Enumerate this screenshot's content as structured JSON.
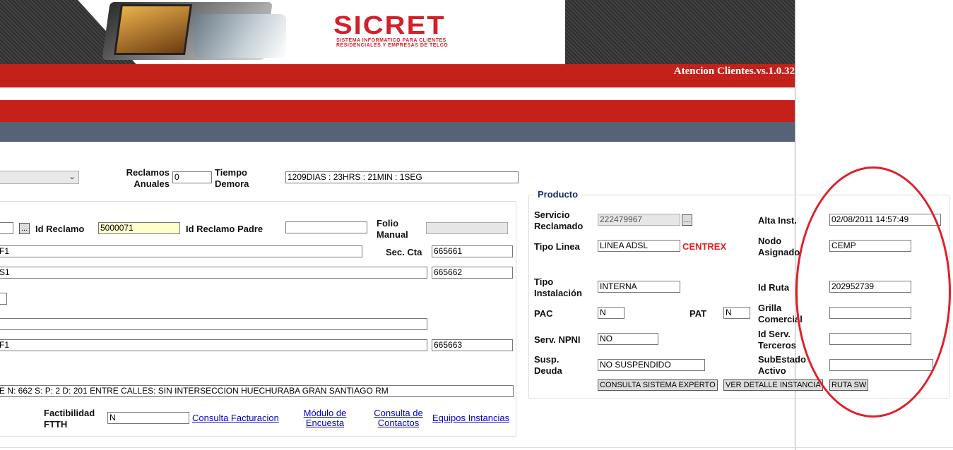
{
  "header": {
    "logo_text": "SICRET",
    "logo_subtitle_1": "SISTEMA INFORMATICO PARA CLIENTES",
    "logo_subtitle_2": "RESIDENCIALES Y EMPRESAS DE TELCO",
    "version": "Atencion Clientes.vs.1.0.32"
  },
  "top": {
    "reclamos_anuales_label_1": "Reclamos",
    "reclamos_anuales_label_2": "Anuales",
    "reclamos_anuales_value": "0",
    "tiempo_demora_label_1": "Tiempo",
    "tiempo_demora_label_2": "Demora",
    "tiempo_demora_value": "1209DIAS : 23HRS : 21MIN : 1SEG"
  },
  "left": {
    "dots_button": "...",
    "id_reclamo_label": "Id Reclamo",
    "id_reclamo_value": "5000071",
    "id_reclamo_padre_label": "Id Reclamo Padre",
    "id_reclamo_padre_value": "",
    "folio_manual_label_1": "Folio",
    "folio_manual_label_2": "Manual",
    "folio_manual_value": "",
    "row1_value": "F1",
    "sec_cta_label": "Sec. Cta",
    "sec_cta_value": "665661",
    "row2_value": "S1",
    "row2_right_value": "665662",
    "row4_value": "F1",
    "row4_right_value": "665663",
    "address_value": "E N: 662 S:  P: 2 D: 201 ENTRE CALLES: SIN INTERSECCION  HUECHURABA GRAN SANTIAGO RM",
    "factibilidad_label_1": "Factibilidad",
    "factibilidad_label_2": "FTTH",
    "factibilidad_value": "N",
    "link_consulta_facturacion": "Consulta Facturacion",
    "link_modulo_encuesta_1": "Módulo de",
    "link_modulo_encuesta_2": "Encuesta",
    "link_consulta_contactos_1": "Consulta de",
    "link_consulta_contactos_2": "Contactos",
    "link_equipos_instancias": "Equipos Instancias"
  },
  "producto": {
    "title": "Producto",
    "servicio_reclamado_label_1": "Servicio",
    "servicio_reclamado_label_2": "Reclamado",
    "servicio_reclamado_value": "222479967",
    "dots_button": "...",
    "alta_inst_label": "Alta Inst.",
    "alta_inst_value": "02/08/2011 14:57:49",
    "tipo_linea_label": "Tipo Linea",
    "tipo_linea_value": "LINEA ADSL",
    "centrex": "CENTREX",
    "nodo_asignado_label_1": "Nodo",
    "nodo_asignado_label_2": "Asignado",
    "nodo_asignado_value": "CEMP",
    "tipo_instalacion_label_1": "Tipo",
    "tipo_instalacion_label_2": "Instalación",
    "tipo_instalacion_value": "INTERNA",
    "id_ruta_label": "Id Ruta",
    "id_ruta_value": "202952739",
    "pac_label": "PAC",
    "pac_value": "N",
    "pat_label": "PAT",
    "pat_value": "N",
    "grilla_comercial_label_1": "Grilla",
    "grilla_comercial_label_2": "Comercial",
    "grilla_comercial_value": "",
    "serv_npni_label": "Serv. NPNI",
    "serv_npni_value": "NO",
    "id_serv_terceros_label_1": "Id Serv.",
    "id_serv_terceros_label_2": "Terceros",
    "id_serv_terceros_value": "",
    "susp_deuda_label_1": "Susp.",
    "susp_deuda_label_2": "Deuda",
    "susp_deuda_value": "NO SUSPENDIDO",
    "subestado_activo_label_1": "SubEstado",
    "subestado_activo_label_2": "Activo",
    "subestado_activo_value": "",
    "btn_consulta_sistema_experto": "CONSULTA SISTEMA EXPERTO",
    "btn_ver_detalle_instancia": "VER DETALLE INSTANCIA",
    "btn_ruta_sw": "RUTA SW"
  },
  "colors": {
    "brand_red": "#c4211a",
    "nav_slate": "#556278",
    "annotation_red": "#e0202a",
    "link_blue": "#0000cc"
  }
}
